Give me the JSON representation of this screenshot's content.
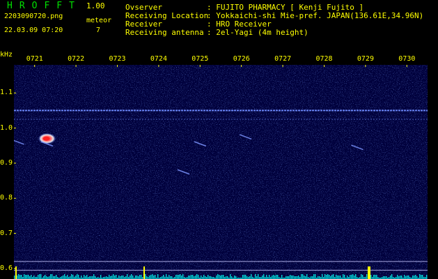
{
  "header": {
    "title": "HROFFT",
    "version": "1.00",
    "file_name": "2203090720.png",
    "date_time": "22.03.09 07:20",
    "meteor_label": "meteor",
    "meteor_count": "7"
  },
  "info": [
    {
      "label": "Ovserver",
      "value": ": FUJITO PHARMACY [ Kenji Fujito ]"
    },
    {
      "label": "Receiving Location",
      "value": ": Yokkaichi-shi Mie-pref. JAPAN(136.61E,34.96N)"
    },
    {
      "label": "Receiver",
      "value": ": HRO Receiver"
    },
    {
      "label": "Receiving antenna",
      "value": ": 2el-Yagi (4m height)"
    }
  ],
  "chart_data": {
    "type": "heatmap",
    "ylabel": "kHz",
    "x_ticks": [
      "0721",
      "0722",
      "0723",
      "0724",
      "0725",
      "0726",
      "0727",
      "0728",
      "0729",
      "0730"
    ],
    "y_ticks": [
      "1.1",
      "1.0",
      "0.9",
      "0.8",
      "0.7",
      "0.6"
    ],
    "y_tick_values": [
      1.1,
      1.0,
      0.9,
      0.8,
      0.7,
      0.6
    ],
    "xlim": [
      720.5,
      730.5
    ],
    "ylim": [
      0.57,
      1.18
    ],
    "carrier_lines_khz": [
      1.05,
      1.025
    ],
    "reference_lines_khz": [
      0.62,
      0.595
    ],
    "meteor_echoes": [
      {
        "time": "0721.3",
        "freq_khz": 0.97,
        "type": "head-echo"
      },
      {
        "time": "0721.3",
        "freq_khz": 0.955,
        "type": "trail"
      },
      {
        "time": "0725.0",
        "freq_khz": 0.955,
        "type": "trail"
      },
      {
        "time": "0726.1",
        "freq_khz": 0.975,
        "type": "trail"
      },
      {
        "time": "0728.8",
        "freq_khz": 0.945,
        "type": "trail"
      },
      {
        "time": "0724.6",
        "freq_khz": 0.875,
        "type": "trail"
      },
      {
        "time": "0720.6",
        "freq_khz": 0.96,
        "type": "trail"
      }
    ],
    "colors": {
      "background": "#00003c",
      "noise": "#2a4cd6",
      "carrier": "#6f8cff",
      "echo_core": "#ff2020",
      "echo_halo": "#ffffff",
      "signal_bar": "#00d8d8",
      "marker": "#ffff00"
    }
  }
}
